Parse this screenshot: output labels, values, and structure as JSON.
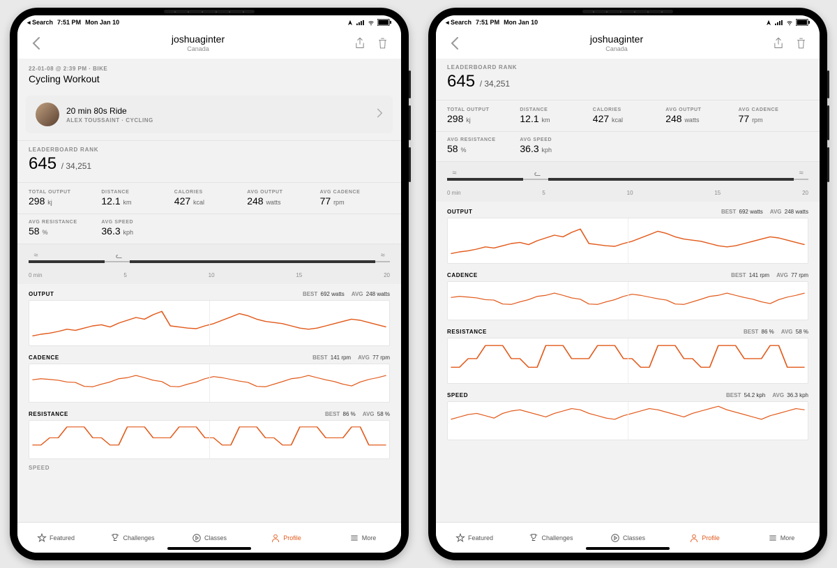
{
  "status": {
    "back": "◂ Search",
    "time": "7:51 PM",
    "date": "Mon Jan 10"
  },
  "header": {
    "title": "joshuaginter",
    "subtitle": "Canada"
  },
  "workout": {
    "meta": "22-01-08 @ 2:39 PM · BIKE",
    "name": "Cycling Workout"
  },
  "class": {
    "title": "20 min 80s Ride",
    "sub": "ALEX TOUSSAINT · CYCLING"
  },
  "rank": {
    "label": "LEADERBOARD RANK",
    "value": "645",
    "total": "/ 34,251"
  },
  "stats": [
    {
      "label": "TOTAL OUTPUT",
      "value": "298",
      "unit": "kj"
    },
    {
      "label": "DISTANCE",
      "value": "12.1",
      "unit": "km"
    },
    {
      "label": "CALORIES",
      "value": "427",
      "unit": "kcal"
    },
    {
      "label": "AVG OUTPUT",
      "value": "248",
      "unit": "watts"
    },
    {
      "label": "AVG CADENCE",
      "value": "77",
      "unit": "rpm"
    },
    {
      "label": "AVG RESISTANCE",
      "value": "58",
      "unit": "%"
    },
    {
      "label": "AVG SPEED",
      "value": "36.3",
      "unit": "kph"
    }
  ],
  "timeline": {
    "ticks": [
      "0 min",
      "5",
      "10",
      "15",
      "20"
    ]
  },
  "charts": [
    {
      "name": "OUTPUT",
      "best": "692 watts",
      "avg": "248 watts"
    },
    {
      "name": "CADENCE",
      "best": "141 rpm",
      "avg": "77 rpm"
    },
    {
      "name": "RESISTANCE",
      "best": "86 %",
      "avg": "58 %"
    },
    {
      "name": "SPEED",
      "best": "54.2 kph",
      "avg": "36.3 kph"
    }
  ],
  "tabs": [
    {
      "label": "Featured"
    },
    {
      "label": "Challenges"
    },
    {
      "label": "Classes"
    },
    {
      "label": "Profile"
    },
    {
      "label": "More"
    }
  ],
  "labels": {
    "best": "BEST",
    "avg": "AVG"
  },
  "chart_data": [
    {
      "type": "line",
      "title": "OUTPUT",
      "ylim": [
        0,
        700
      ],
      "x": "0–20 min",
      "series": [
        {
          "name": "Output",
          "best": 692,
          "avg": 248,
          "values": [
            120,
            150,
            170,
            200,
            240,
            220,
            260,
            300,
            320,
            280,
            350,
            400,
            450,
            420,
            500,
            560,
            300,
            280,
            260,
            250,
            300,
            340,
            400,
            460,
            520,
            480,
            420,
            380,
            360,
            340,
            300,
            260,
            240,
            260,
            300,
            340,
            380,
            420,
            400,
            360,
            320,
            280
          ]
        }
      ]
    },
    {
      "type": "line",
      "title": "CADENCE",
      "ylim": [
        0,
        150
      ],
      "x": "0–20 min",
      "series": [
        {
          "name": "Cadence",
          "best": 141,
          "avg": 77,
          "values": [
            90,
            95,
            92,
            88,
            80,
            78,
            60,
            58,
            70,
            80,
            95,
            100,
            110,
            100,
            88,
            82,
            60,
            58,
            70,
            80,
            95,
            105,
            100,
            92,
            84,
            78,
            60,
            58,
            70,
            82,
            95,
            100,
            110,
            100,
            90,
            82,
            70,
            62,
            80,
            92,
            100,
            110
          ]
        }
      ]
    },
    {
      "type": "line",
      "title": "RESISTANCE",
      "ylim": [
        0,
        90
      ],
      "x": "0–20 min",
      "series": [
        {
          "name": "Resistance",
          "best": 86,
          "avg": 58,
          "values": [
            30,
            30,
            50,
            50,
            80,
            80,
            80,
            50,
            50,
            30,
            30,
            80,
            80,
            80,
            50,
            50,
            50,
            80,
            80,
            80,
            50,
            50,
            30,
            30,
            80,
            80,
            80,
            50,
            50,
            30,
            30,
            80,
            80,
            80,
            50,
            50,
            50,
            80,
            80,
            30,
            30,
            30
          ]
        }
      ]
    },
    {
      "type": "line",
      "title": "SPEED",
      "ylim": [
        0,
        55
      ],
      "x": "0–20 min",
      "series": [
        {
          "name": "Speed",
          "best": 54.2,
          "avg": 36.3,
          "values": [
            30,
            34,
            38,
            40,
            36,
            32,
            40,
            44,
            46,
            42,
            38,
            34,
            40,
            44,
            48,
            46,
            40,
            36,
            32,
            30,
            36,
            40,
            44,
            48,
            46,
            42,
            38,
            34,
            40,
            44,
            48,
            52,
            46,
            42,
            38,
            34,
            30,
            36,
            40,
            44,
            48,
            46
          ]
        }
      ]
    }
  ]
}
